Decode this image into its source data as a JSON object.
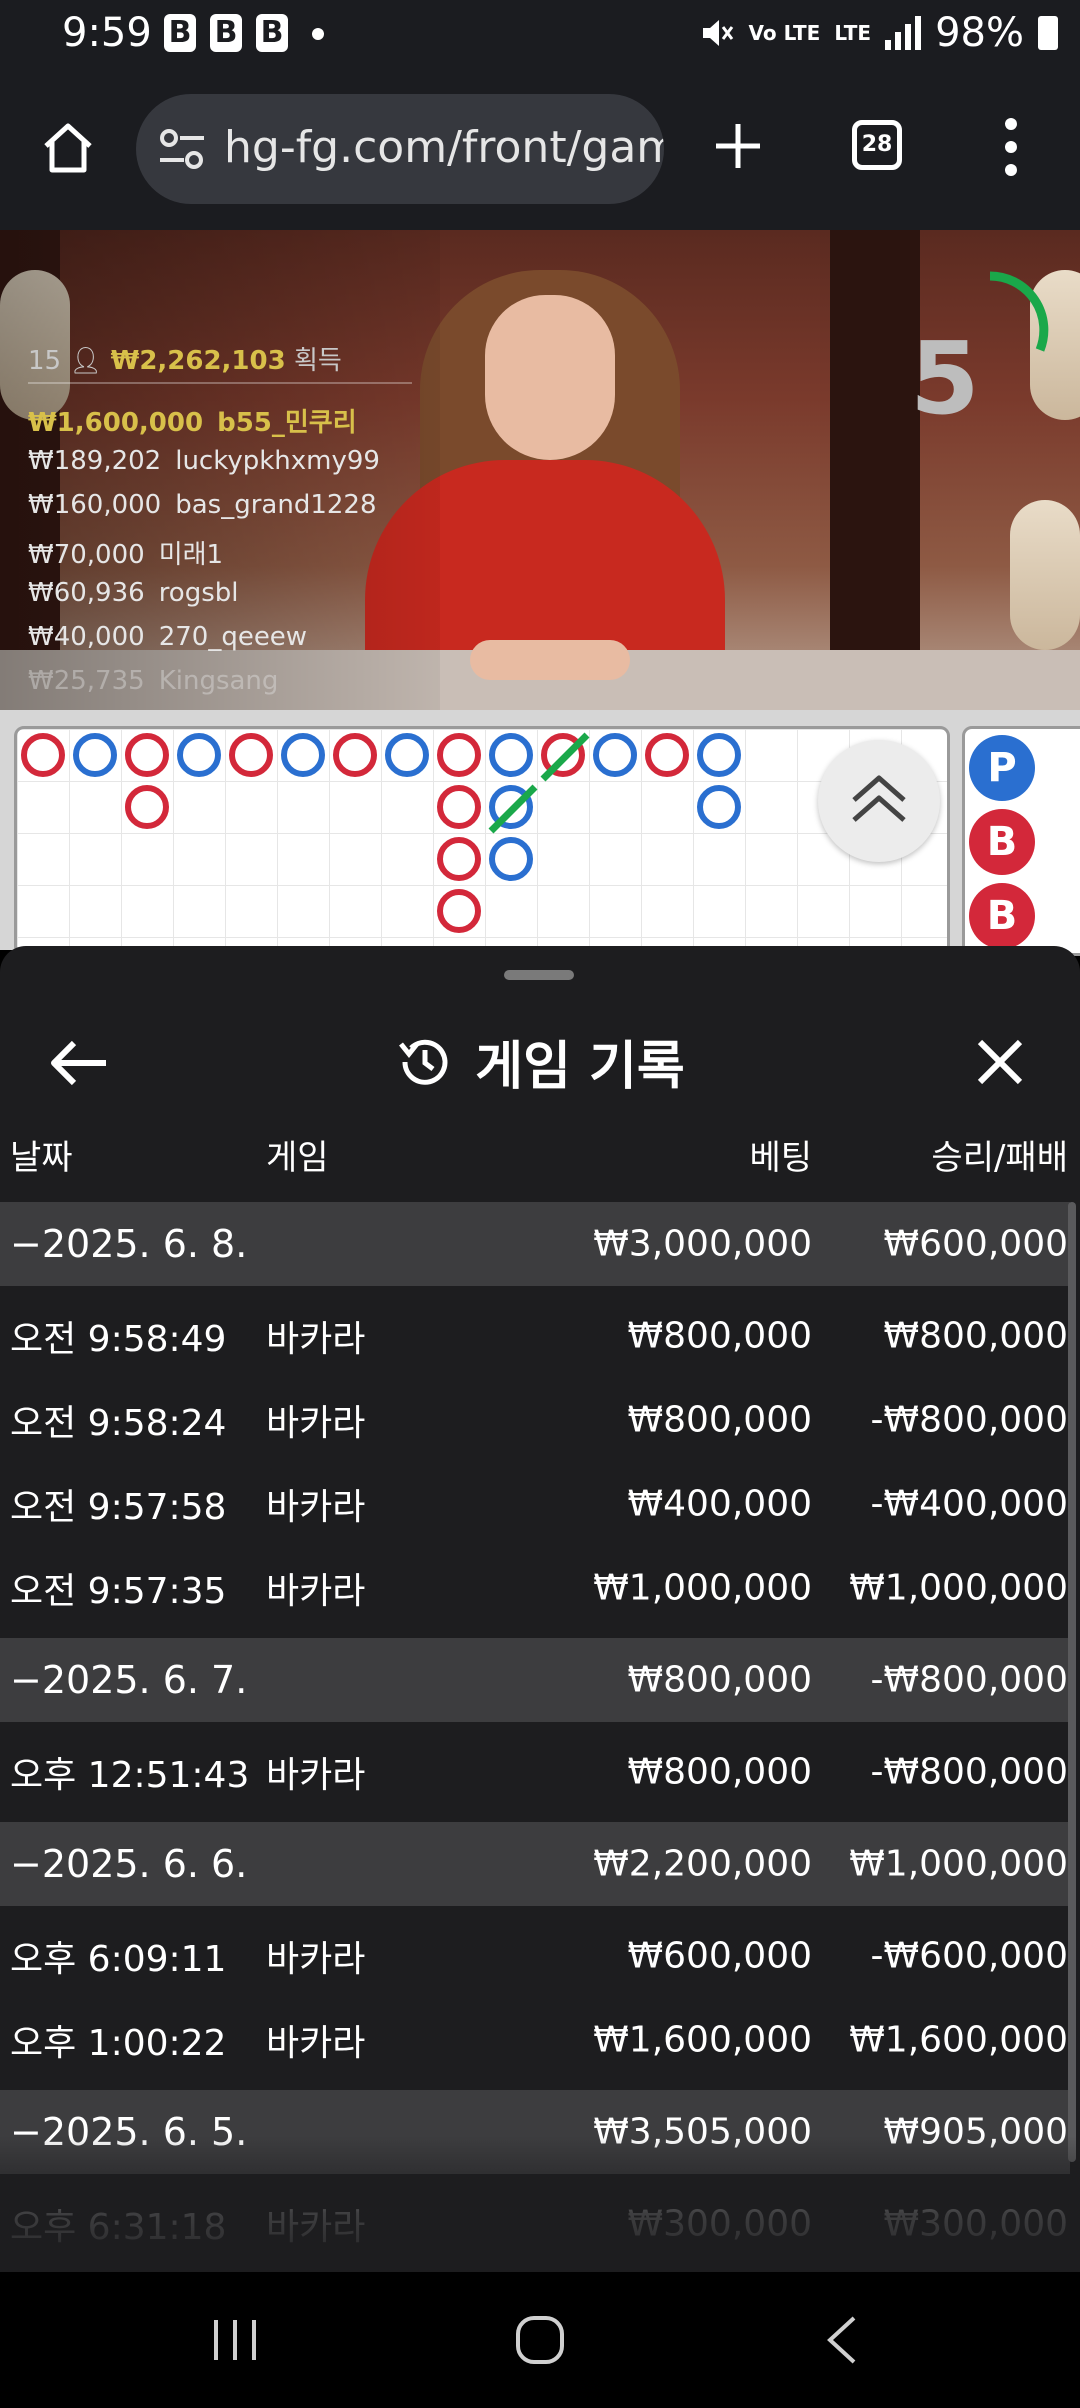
{
  "status_bar": {
    "time": "9:59",
    "b_label": "B",
    "volte": "Vo LTE",
    "lte": "LTE",
    "battery": "98%"
  },
  "browser": {
    "url": "hg-fg.com/front/gam",
    "tab_count": "28"
  },
  "video": {
    "winners_count": "15",
    "winners_total": "₩2,262,103",
    "winners_suffix": "획득",
    "winners": [
      {
        "amount": "₩1,600,000",
        "name": "b55_민쿠리"
      },
      {
        "amount": "₩189,202",
        "name": "luckypkhxmy99"
      },
      {
        "amount": "₩160,000",
        "name": "bas_grand1228"
      },
      {
        "amount": "₩70,000",
        "name": "미래1"
      },
      {
        "amount": "₩60,936",
        "name": "rogsbl"
      },
      {
        "amount": "₩40,000",
        "name": "270_qeeew"
      },
      {
        "amount": "₩25,735",
        "name": "Kingsang"
      }
    ],
    "countdown": "5"
  },
  "road": {
    "side_chips": [
      "P",
      "B",
      "B"
    ]
  },
  "sheet": {
    "title": "게임 기록",
    "columns": {
      "date": "날짜",
      "game": "게임",
      "bet": "베팅",
      "result": "승리/패배"
    },
    "rows": [
      {
        "type": "group",
        "date": "−2025. 6. 8.",
        "game": "",
        "bet": "₩3,000,000",
        "result": "₩600,000"
      },
      {
        "type": "item",
        "date": "오전 9:58:49",
        "game": "바카라",
        "bet": "₩800,000",
        "result": "₩800,000"
      },
      {
        "type": "item",
        "date": "오전 9:58:24",
        "game": "바카라",
        "bet": "₩800,000",
        "result": "-₩800,000"
      },
      {
        "type": "item",
        "date": "오전 9:57:58",
        "game": "바카라",
        "bet": "₩400,000",
        "result": "-₩400,000"
      },
      {
        "type": "item",
        "date": "오전 9:57:35",
        "game": "바카라",
        "bet": "₩1,000,000",
        "result": "₩1,000,000"
      },
      {
        "type": "group",
        "date": "−2025. 6. 7.",
        "game": "",
        "bet": "₩800,000",
        "result": "-₩800,000"
      },
      {
        "type": "item",
        "date": "오후 12:51:43",
        "game": "바카라",
        "bet": "₩800,000",
        "result": "-₩800,000"
      },
      {
        "type": "group",
        "date": "−2025. 6. 6.",
        "game": "",
        "bet": "₩2,200,000",
        "result": "₩1,000,000"
      },
      {
        "type": "item",
        "date": "오후 6:09:11",
        "game": "바카라",
        "bet": "₩600,000",
        "result": "-₩600,000"
      },
      {
        "type": "item",
        "date": "오후 1:00:22",
        "game": "바카라",
        "bet": "₩1,600,000",
        "result": "₩1,600,000"
      },
      {
        "type": "group",
        "date": "−2025. 6. 5.",
        "game": "",
        "bet": "₩3,505,000",
        "result": "₩905,000"
      },
      {
        "type": "item",
        "date": "오후 6:31:18",
        "game": "바카라",
        "bet": "₩300,000",
        "result": "₩300,000"
      }
    ]
  },
  "colors": {
    "player": "#2a6fd0",
    "banker": "#d3283a",
    "winner_gold": "#d8c04a",
    "timer_green": "#1aa84a"
  },
  "icons": {
    "home": "home-icon",
    "site_settings": "tune-icon",
    "new_tab": "plus-icon",
    "menu": "more-vert-icon",
    "back": "arrow-left-icon",
    "history": "history-icon",
    "close": "close-icon"
  }
}
